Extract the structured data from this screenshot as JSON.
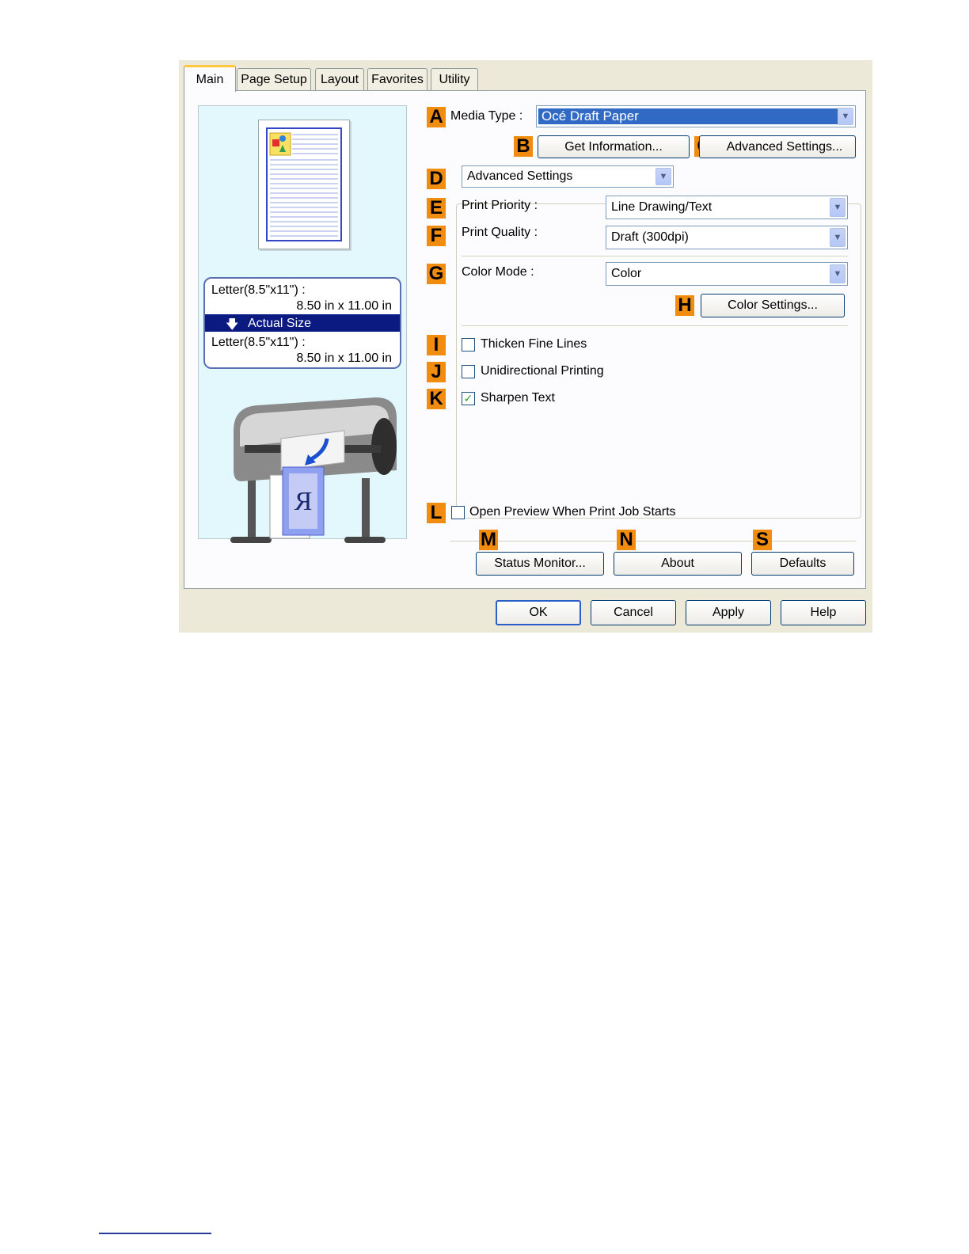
{
  "tabs": [
    "Main",
    "Page Setup",
    "Layout",
    "Favorites",
    "Utility"
  ],
  "preview": {
    "input_size": "Letter(8.5\"x11\") :",
    "input_dims": "8.50 in x 11.00 in",
    "scaling": "Actual Size",
    "output_size": "Letter(8.5\"x11\") :",
    "output_dims": "8.50 in x 11.00 in",
    "printer_glyph": "R"
  },
  "tags": {
    "A": "A",
    "B": "B",
    "C": "C",
    "D": "D",
    "E": "E",
    "F": "F",
    "G": "G",
    "H": "H",
    "I": "I",
    "J": "J",
    "K": "K",
    "L": "L",
    "M": "M",
    "N": "N",
    "S": "S"
  },
  "media_type": {
    "label": "Media Type :",
    "value": "Océ Draft Paper"
  },
  "buttons": {
    "get_info": "Get Information...",
    "advanced_settings": "Advanced Settings...",
    "color_settings": "Color Settings...",
    "status_monitor": "Status Monitor...",
    "about": "About",
    "defaults": "Defaults",
    "ok": "OK",
    "cancel": "Cancel",
    "apply": "Apply",
    "help": "Help"
  },
  "mode_select": "Advanced Settings",
  "print_priority": {
    "label": "Print Priority :",
    "value": "Line Drawing/Text"
  },
  "print_quality": {
    "label": "Print Quality :",
    "value": "Draft (300dpi)"
  },
  "color_mode": {
    "label": "Color Mode :",
    "value": "Color"
  },
  "checkboxes": {
    "thicken": {
      "label": "Thicken Fine Lines",
      "checked": false
    },
    "unidirectional": {
      "label": "Unidirectional Printing",
      "checked": false
    },
    "sharpen": {
      "label": "Sharpen Text",
      "checked": true
    },
    "open_preview": {
      "label": "Open Preview When Print Job Starts",
      "checked": false
    }
  },
  "colors": {
    "accent_tag": "#f08c10",
    "selected": "#316ac5",
    "scaling_bar": "#0a1a80"
  }
}
